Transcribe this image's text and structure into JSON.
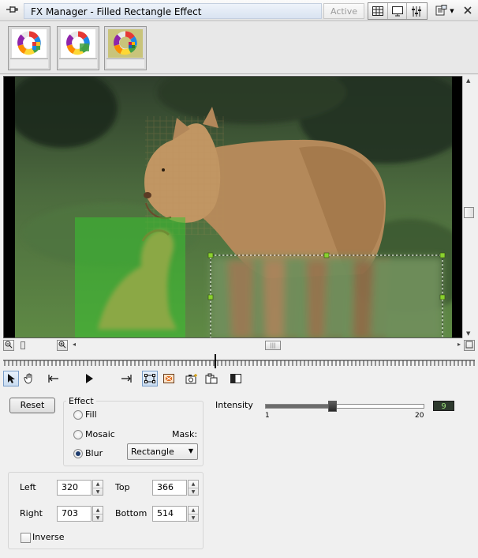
{
  "window": {
    "title": "FX Manager - Filled Rectangle Effect",
    "status": "Active"
  },
  "thumbnails": [
    {
      "name": "effect-1",
      "selected": false
    },
    {
      "name": "effect-2",
      "selected": false
    },
    {
      "name": "effect-3",
      "selected": true
    }
  ],
  "effect": {
    "group_title": "Effect",
    "options": [
      "Fill",
      "Mosaic",
      "Blur"
    ],
    "selected": "Blur",
    "mask_label": "Mask:",
    "mask_value": "Rectangle"
  },
  "reset_label": "Reset",
  "intensity": {
    "label": "Intensity",
    "value": "9",
    "min": "1",
    "max": "20",
    "fraction": 0.42
  },
  "rect": {
    "left_label": "Left",
    "left": "320",
    "top_label": "Top",
    "top": "366",
    "right_label": "Right",
    "right": "703",
    "bottom_label": "Bottom",
    "bottom": "514"
  },
  "inverse": {
    "label": "Inverse",
    "checked": false
  },
  "icons": {
    "titlebar": [
      "pin-icon",
      "grid-view-icon",
      "monitor-icon",
      "sliders-icon",
      "properties-menu-icon",
      "close-icon"
    ],
    "tools": [
      "pointer-icon",
      "hand-icon",
      "go-start-icon",
      "play-icon",
      "go-end-icon",
      "rectangle-select-icon",
      "fill-effect-icon",
      "snapshot-icon",
      "paste-icon",
      "split-view-icon"
    ]
  },
  "colors": {
    "accent": "#7a9ec9",
    "selection_handles": "#8ad12e",
    "intensity_led": "#9be27a"
  }
}
